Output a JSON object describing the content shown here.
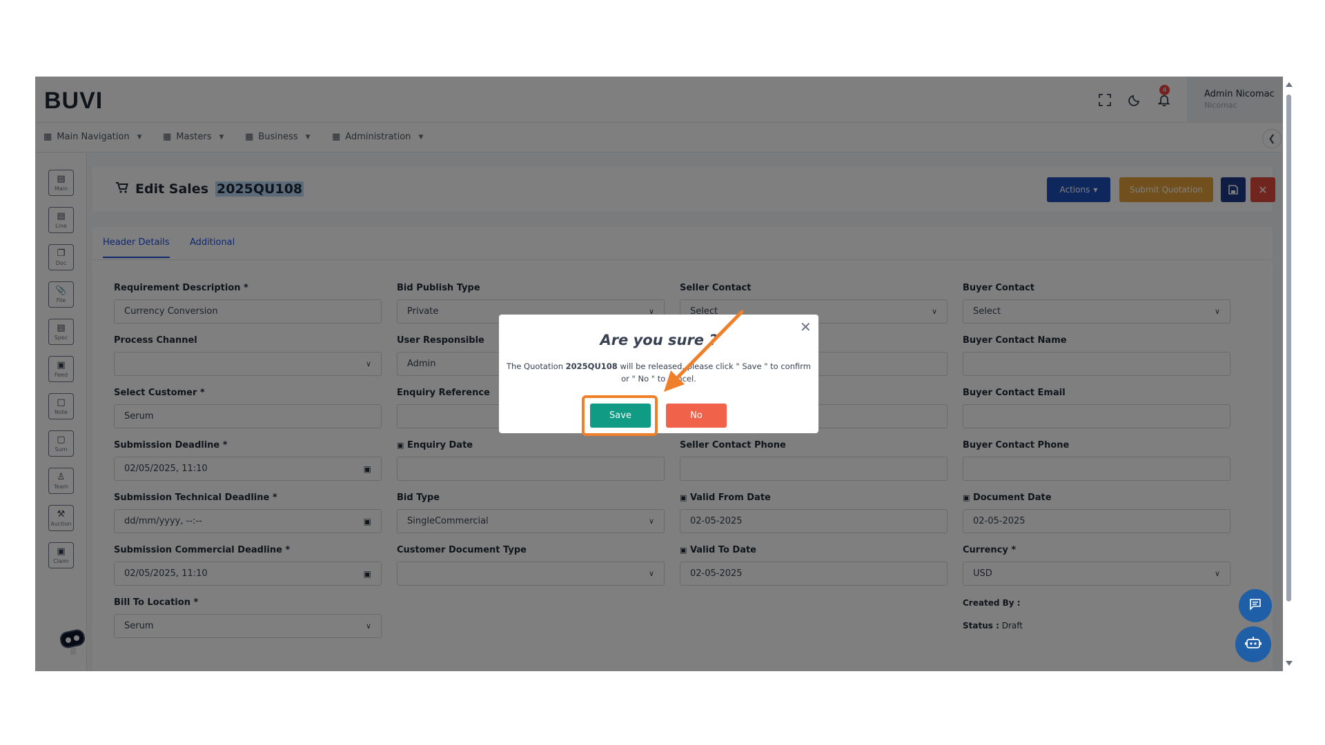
{
  "app": {
    "logo": "BUVI",
    "notification_count": "4",
    "user_name": "Admin Nicomac",
    "user_org": "Nicomac"
  },
  "nav": {
    "items": [
      {
        "label": "Main Navigation"
      },
      {
        "label": "Masters"
      },
      {
        "label": "Business"
      },
      {
        "label": "Administration"
      }
    ]
  },
  "sidebar": {
    "items": [
      {
        "label": "Main",
        "icon": "document-icon"
      },
      {
        "label": "Line",
        "icon": "list-icon"
      },
      {
        "label": "Doc",
        "icon": "copy-icon"
      },
      {
        "label": "File",
        "icon": "paperclip-icon"
      },
      {
        "label": "Spec",
        "icon": "spec-icon"
      },
      {
        "label": "Feed",
        "icon": "feed-icon"
      },
      {
        "label": "Note",
        "icon": "note-icon"
      },
      {
        "label": "Sum",
        "icon": "summary-icon"
      },
      {
        "label": "Team",
        "icon": "team-icon"
      },
      {
        "label": "Auction",
        "icon": "gavel-icon"
      },
      {
        "label": "Claim",
        "icon": "claim-icon"
      }
    ]
  },
  "header": {
    "title_prefix": "Edit Sales",
    "quote_code": "2025QU108",
    "actions_label": "Actions",
    "submit_label": "Submit Quotation"
  },
  "tabs": [
    {
      "label": "Header Details",
      "active": true
    },
    {
      "label": "Additional",
      "active": false
    }
  ],
  "form": {
    "requirement_description": {
      "label": "Requirement Description *",
      "value": "Currency Conversion"
    },
    "process_channel": {
      "label": "Process Channel",
      "value": ""
    },
    "select_customer": {
      "label": "Select Customer *",
      "value": "Serum"
    },
    "submission_deadline": {
      "label": "Submission Deadline *",
      "value": "02/05/2025, 11:10"
    },
    "submission_technical_deadline": {
      "label": "Submission Technical Deadline *",
      "value": "dd/mm/yyyy, --:--"
    },
    "submission_commercial_deadline": {
      "label": "Submission Commercial Deadline *",
      "value": "02/05/2025, 11:10"
    },
    "bill_to_location": {
      "label": "Bill To Location *",
      "value": "Serum"
    },
    "bid_publish_type": {
      "label": "Bid Publish Type",
      "value": "Private"
    },
    "user_responsible": {
      "label": "User Responsible",
      "value": "Admin"
    },
    "enquiry_reference": {
      "label": "Enquiry Reference",
      "value": ""
    },
    "enquiry_date": {
      "label": "Enquiry Date",
      "value": ""
    },
    "bid_type": {
      "label": "Bid Type",
      "value": "SingleCommercial"
    },
    "customer_document_type": {
      "label": "Customer Document Type",
      "value": ""
    },
    "seller_contact": {
      "label": "Seller Contact",
      "value": "Select"
    },
    "seller_contact_name": {
      "value": ""
    },
    "seller_contact_email": {
      "value": ""
    },
    "seller_contact_phone": {
      "label": "Seller Contact Phone",
      "value": ""
    },
    "valid_from_date": {
      "label": "Valid From Date",
      "value": "02-05-2025"
    },
    "valid_to_date": {
      "label": "Valid To Date",
      "value": "02-05-2025"
    },
    "buyer_contact": {
      "label": "Buyer Contact",
      "value": "Select"
    },
    "buyer_contact_name": {
      "label": "Buyer Contact Name",
      "value": ""
    },
    "buyer_contact_email": {
      "label": "Buyer Contact Email",
      "value": ""
    },
    "buyer_contact_phone": {
      "label": "Buyer Contact Phone",
      "value": ""
    },
    "document_date": {
      "label": "Document Date",
      "value": "02-05-2025"
    },
    "currency": {
      "label": "Currency *",
      "value": "USD"
    },
    "created_by_label": "Created By :",
    "status_label": "Status :",
    "status_value": "Draft"
  },
  "modal": {
    "title": "Are you sure ?",
    "msg_prefix": "The Quotation ",
    "msg_code": "2025QU108",
    "msg_suffix": " will be released, please click \" Save \" to confirm or \" No \" to cancel.",
    "save_label": "Save",
    "no_label": "No"
  },
  "colors": {
    "save": "#109c84",
    "no": "#f1624b",
    "highlight": "#f07f2a",
    "actions": "#1d4fb8",
    "submit": "#e3a03a",
    "close": "#e14a3c"
  }
}
